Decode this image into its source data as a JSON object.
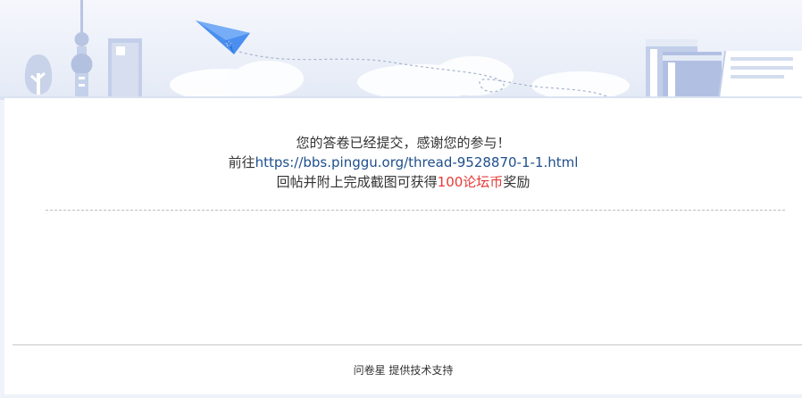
{
  "message": {
    "line1": "您的答卷已经提交，感谢您的参与！",
    "line2_prefix": "前往",
    "link_url": "https://bbs.pinggu.org/thread-9528870-1-1.html",
    "line3_prefix": "回帖并附上完成截图可获得",
    "reward": "100论坛币",
    "line3_suffix": "奖励"
  },
  "footer": {
    "brand": "问卷星",
    "tagline": "提供技术支持"
  },
  "colors": {
    "background": "#eef2f9",
    "card": "#ffffff",
    "text": "#333333",
    "link": "#1e4f8c",
    "reward": "#e53935",
    "plane": "#4a8ff0"
  },
  "decoration": {
    "banner_icons": [
      "tree-icon",
      "tv-tower-icon",
      "skyscraper-icon",
      "paper-plane-icon",
      "books-icon",
      "open-book-icon"
    ]
  }
}
